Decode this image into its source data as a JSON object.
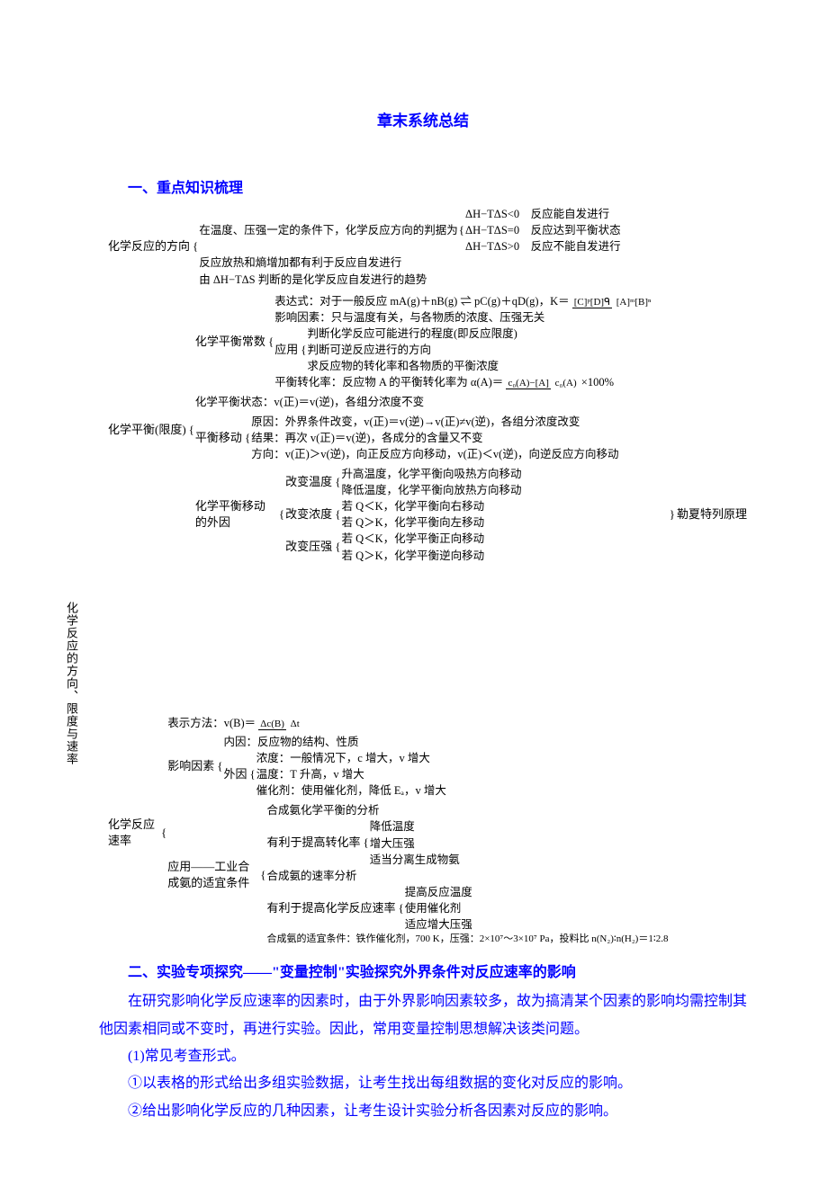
{
  "title": "章末系统总结",
  "section1_header": "一、重点知识梳理",
  "root_label": "化学反应的方向、限度与速率",
  "tree": {
    "direction": {
      "label": "化学反应的方向",
      "line1_prefix": "在温度、压强一定的条件下，化学反应方向的判据为",
      "cases": [
        "ΔH−TΔS<0　反应能自发进行",
        "ΔH−TΔS=0　反应达到平衡状态",
        "ΔH−TΔS>0　反应不能自发进行"
      ],
      "line2": "反应放热和熵增加都有利于反应自发进行",
      "line3": "由 ΔH−TΔS 判断的是化学反应自发进行的趋势"
    },
    "equilibrium": {
      "label": "化学平衡(限度)",
      "constant": {
        "label": "化学平衡常数",
        "expr_prefix": "表达式：对于一般反应 mA(g)＋nB(g) ⇌ pC(g)＋qD(g)，K＝",
        "expr_num": "[C]ᵖ[D]ᑫ",
        "expr_den": "[A]ᵐ[B]ⁿ",
        "factors": "影响因素：只与温度有关，与各物质的浓度、压强无关",
        "apply_label": "应用",
        "apply_items": [
          "判断化学反应可能进行的程度(即反应限度)",
          "判断可逆反应进行的方向",
          "求反应物的转化率和各物质的平衡浓度"
        ],
        "conv_prefix": "平衡转化率：反应物 A 的平衡转化率为 α(A)＝",
        "conv_num": "c₀(A)−[A]",
        "conv_den": "c₀(A)",
        "conv_suffix": "×100%"
      },
      "state": "化学平衡状态：v(正)＝v(逆)，各组分浓度不变",
      "shift": {
        "label": "平衡移动",
        "items": [
          "原因：外界条件改变，v(正)＝v(逆)→v(正)≠v(逆)，各组分浓度改变",
          "结果：再次 v(正)＝v(逆)，各成分的含量又不变",
          "方向：v(正)＞v(逆)，向正反应方向移动，v(正)＜v(逆)，向逆反应方向移动"
        ]
      },
      "external": {
        "label": "化学平衡移动的外因",
        "temp_label": "改变温度",
        "temp_items": [
          "升高温度，化学平衡向吸热方向移动",
          "降低温度，化学平衡向放热方向移动"
        ],
        "conc_label": "改变浓度",
        "conc_items": [
          "若 Q＜K，化学平衡向右移动",
          "若 Q＞K，化学平衡向左移动"
        ],
        "press_label": "改变压强",
        "press_items": [
          "若 Q＜K，化学平衡正向移动",
          "若 Q＞K，化学平衡逆向移动"
        ],
        "principle": "勒夏特列原理"
      }
    },
    "rate": {
      "label": "化学反应速率",
      "expr_label": "表示方法：v(B)＝",
      "expr_num": "Δc(B)",
      "expr_den": "Δt",
      "factors": {
        "label": "影响因素",
        "internal": "内因：反应物的结构、性质",
        "external_label": "外因",
        "external_items": [
          "浓度：一般情况下，c 增大，v 增大",
          "温度：T 升高，v 增大",
          "催化剂：使用催化剂，降低 Eₐ，v 增大"
        ]
      },
      "application": {
        "label": "应用——工业合成氨的适宜条件",
        "analysis": "合成氨化学平衡的分析",
        "conv_label": "有利于提高转化率",
        "conv_items": [
          "降低温度",
          "增大压强",
          "适当分离生成物氨"
        ],
        "rate_analysis": "合成氨的速率分析",
        "rate_label": "有利于提高化学反应速率",
        "rate_items": [
          "提高反应温度",
          "使用催化剂",
          "适应增大压强"
        ],
        "conditions": "合成氨的适宜条件：铁作催化剂，700 K，压强：2×10⁷～3×10⁷ Pa，投料比 n(N₂)∶n(H₂)＝1∶2.8"
      }
    }
  },
  "section2_header": "二、实验专项探究——\"变量控制\"实验探究外界条件对反应速率的影响",
  "para1": "在研究影响化学反应速率的因素时，由于外界影响因素较多，故为搞清某个因素的影响均需控制其他因素相同或不变时，再进行实验。因此，常用变量控制思想解决该类问题。",
  "sub1": "(1)常见考查形式。",
  "item1": "①以表格的形式给出多组实验数据，让考生找出每组数据的变化对反应的影响。",
  "item2": "②给出影响化学反应的几种因素，让考生设计实验分析各因素对反应的影响。"
}
